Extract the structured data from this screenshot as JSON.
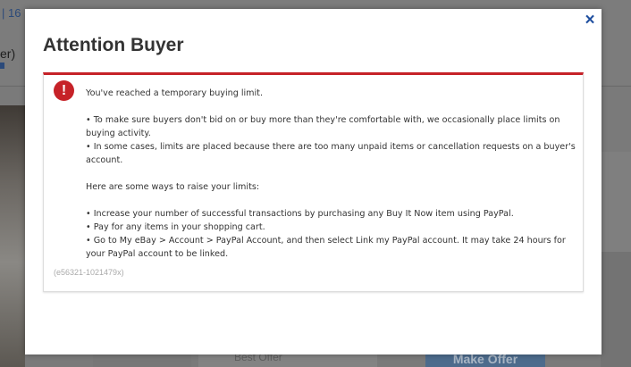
{
  "background": {
    "top_link_fragment": "| 16",
    "side_text_fragment": "er)",
    "best_offer_placeholder": "Best Offer",
    "make_offer_button": "Make Offer"
  },
  "modal": {
    "title": "Attention Buyer",
    "close_icon": "×",
    "alert": {
      "icon": "!",
      "heading": "You've reached a temporary buying limit.",
      "reasons": [
        "• To make sure buyers don't bid on or buy more than they're comfortable with, we occasionally place limits on buying activity.",
        "• In some cases, limits are placed because there are too many unpaid items or cancellation requests on a buyer's account."
      ],
      "ways_heading": "Here are some ways to raise your limits:",
      "ways": [
        "• Increase your number of successful transactions by purchasing any Buy It Now item using PayPal.",
        "• Pay for any items in your shopping cart.",
        "• Go to My eBay > Account > PayPal Account, and then select Link my PayPal account. It may take 24 hours for your PayPal account to be linked."
      ],
      "error_code": "(e56321-1021479x)"
    }
  },
  "colors": {
    "alert_red": "#c62228",
    "close_blue": "#1f4f9f",
    "overlay": "#7a7a7a"
  }
}
